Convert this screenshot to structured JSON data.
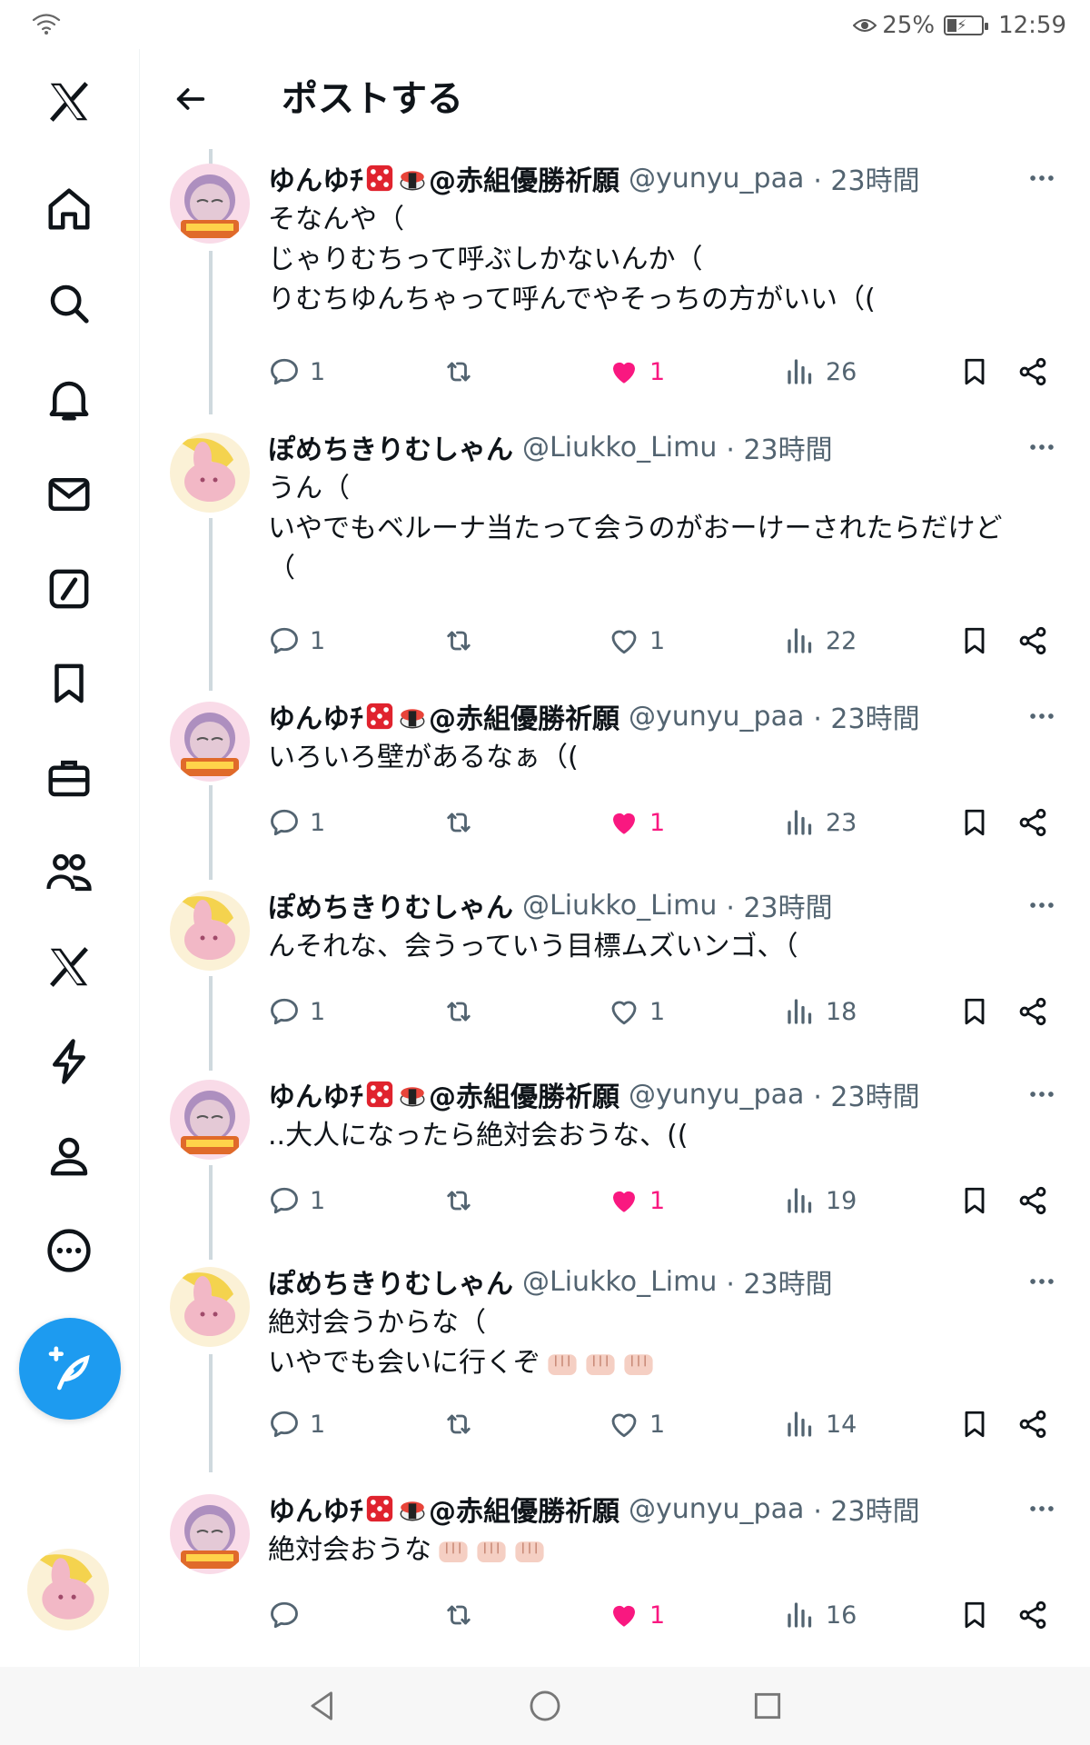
{
  "status_bar": {
    "battery": "25%",
    "time": "12:59"
  },
  "header": {
    "title": "ポストする"
  },
  "sidebar": {
    "items": [
      "x-logo",
      "home",
      "search",
      "notifications",
      "messages",
      "grok",
      "bookmarks",
      "jobs",
      "communities",
      "premium",
      "verified-orgs",
      "profile",
      "more"
    ]
  },
  "posts": [
    {
      "name": "ゆんゆﾁ",
      "name_suffix": "@赤組優勝祈願",
      "handle": "@yunyu_paa",
      "time": "· 23時間",
      "lines": [
        "そなんや（",
        "じゃりむちって呼ぶしかないんか（",
        "りむちゆんちゃって呼んでやそっちの方がいい（("
      ],
      "replies": "1",
      "reposts": "",
      "likes": "1",
      "liked": true,
      "views": "26"
    },
    {
      "name": "ぽめちきりむしゃん",
      "name_suffix": "",
      "handle": "@Liukko_Limu",
      "time": "· 23時間",
      "lines": [
        "うん（",
        "いやでもベルーナ当たって会うのがおーけーされたらだけど",
        "（"
      ],
      "replies": "1",
      "reposts": "",
      "likes": "1",
      "liked": false,
      "views": "22"
    },
    {
      "name": "ゆんゆﾁ",
      "name_suffix": "@赤組優勝祈願",
      "handle": "@yunyu_paa",
      "time": "· 23時間",
      "lines": [
        "いろいろ壁があるなぁ（("
      ],
      "replies": "1",
      "reposts": "",
      "likes": "1",
      "liked": true,
      "views": "23"
    },
    {
      "name": "ぽめちきりむしゃん",
      "name_suffix": "",
      "handle": "@Liukko_Limu",
      "time": "· 23時間",
      "lines": [
        "んそれな、会うっていう目標ムズいンゴ、（"
      ],
      "replies": "1",
      "reposts": "",
      "likes": "1",
      "liked": false,
      "views": "18"
    },
    {
      "name": "ゆんゆﾁ",
      "name_suffix": "@赤組優勝祈願",
      "handle": "@yunyu_paa",
      "time": "· 23時間",
      "lines": [
        "..大人になったら絶対会おうな、(("
      ],
      "replies": "1",
      "reposts": "",
      "likes": "1",
      "liked": true,
      "views": "19"
    },
    {
      "name": "ぽめちきりむしゃん",
      "name_suffix": "",
      "handle": "@Liukko_Limu",
      "time": "· 23時間",
      "lines": [
        "絶対会うからな（",
        "いやでも会いに行くぞ"
      ],
      "replies": "1",
      "reposts": "",
      "likes": "1",
      "liked": false,
      "views": "14"
    },
    {
      "name": "ゆんゆﾁ",
      "name_suffix": "@赤組優勝祈願",
      "handle": "@yunyu_paa",
      "time": "· 23時間",
      "lines": [
        "絶対会おうな"
      ],
      "replies": "",
      "reposts": "",
      "likes": "1",
      "liked": true,
      "views": "16"
    }
  ]
}
